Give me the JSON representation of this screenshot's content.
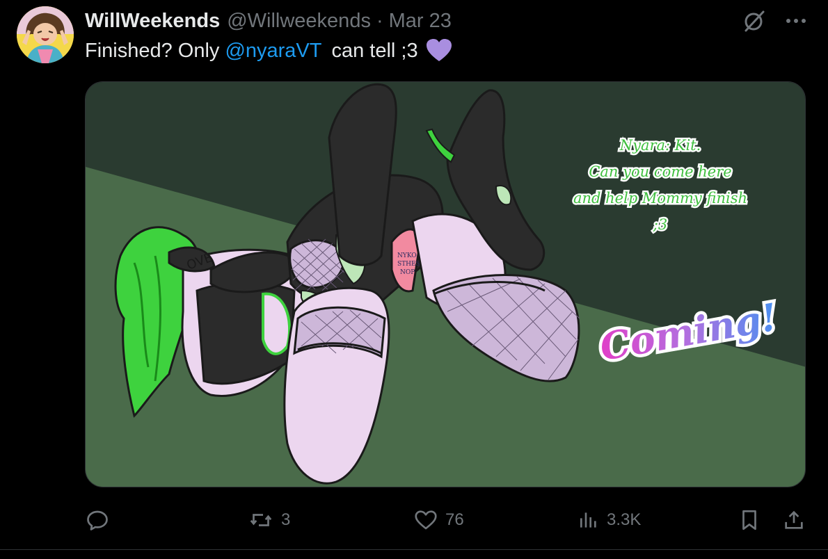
{
  "tweet": {
    "author": {
      "display_name": "WillWeekends",
      "handle": "@Willweekends",
      "separator": "·",
      "date": "Mar 23"
    },
    "text": {
      "before": "Finished? Only",
      "mention": "@nyaraVT",
      "after": "can tell ;3",
      "emoji": "purple-heart"
    },
    "media": {
      "speech_bubble": [
        "Nyara: Kit.",
        "Can you come here",
        "and help Mommy finish",
        ";3"
      ],
      "exclamation": "Coming!",
      "collar_text": "OVE",
      "patch_text": [
        "NYKO",
        "STHES",
        "NOP"
      ]
    },
    "actions": {
      "reply_count": "",
      "repost_count": "3",
      "like_count": "76",
      "views_count": "3.3K"
    },
    "colors": {
      "background": "#000000",
      "text_primary": "#e7e9ea",
      "text_secondary": "#71767b",
      "link": "#1d9bf0",
      "heart": "#a98ee0",
      "bubble_text": "#3fbf3f"
    }
  }
}
